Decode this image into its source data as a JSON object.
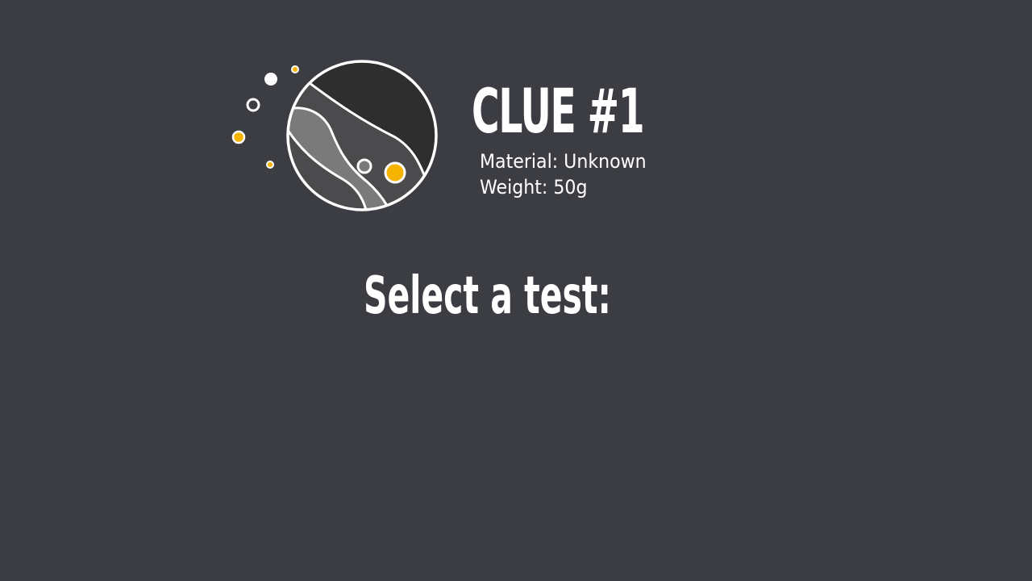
{
  "clue": {
    "title": "CLUE #1",
    "material": "Material: Unknown",
    "weight": "Weight: 50g"
  },
  "prompt": {
    "heading": "Select a test:"
  },
  "icon": {
    "name": "planet-icon"
  },
  "colors": {
    "background": "#3c3d43",
    "text": "#ffffff",
    "accent": "#f5b400",
    "planet_dark": "#2e2e2e",
    "planet_mid": "#4b4b4d",
    "planet_light": "#7a7a7a"
  }
}
